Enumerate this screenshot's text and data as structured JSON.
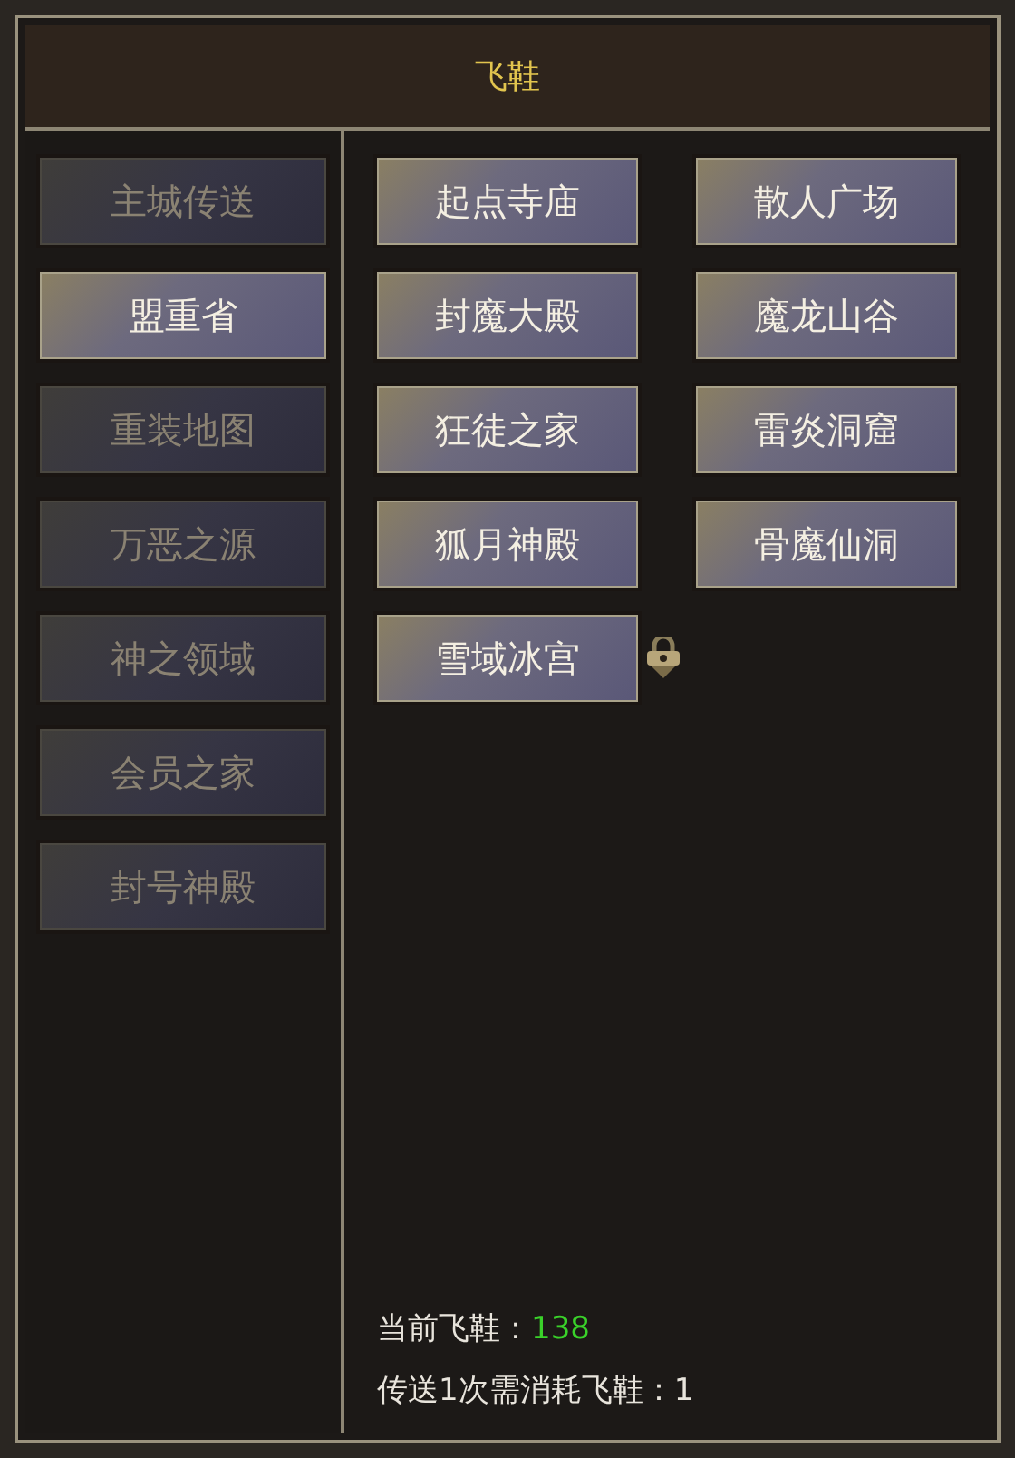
{
  "window": {
    "title": "飞鞋"
  },
  "sidebar": {
    "items": [
      {
        "label": "主城传送",
        "selected": false
      },
      {
        "label": "盟重省",
        "selected": true
      },
      {
        "label": "重装地图",
        "selected": false
      },
      {
        "label": "万恶之源",
        "selected": false
      },
      {
        "label": "神之领域",
        "selected": false
      },
      {
        "label": "会员之家",
        "selected": false
      },
      {
        "label": "封号神殿",
        "selected": false
      }
    ]
  },
  "destinations": [
    {
      "label": "起点寺庙",
      "locked": false
    },
    {
      "label": "散人广场",
      "locked": false
    },
    {
      "label": "封魔大殿",
      "locked": false
    },
    {
      "label": "魔龙山谷",
      "locked": false
    },
    {
      "label": "狂徒之家",
      "locked": false
    },
    {
      "label": "雷炎洞窟",
      "locked": false
    },
    {
      "label": "狐月神殿",
      "locked": false
    },
    {
      "label": "骨魔仙洞",
      "locked": false
    },
    {
      "label": "雪域冰宫",
      "locked": true
    }
  ],
  "footer": {
    "current_label": "当前飞鞋：",
    "current_value": "138",
    "cost_text": "传送1次需消耗飞鞋：1"
  }
}
